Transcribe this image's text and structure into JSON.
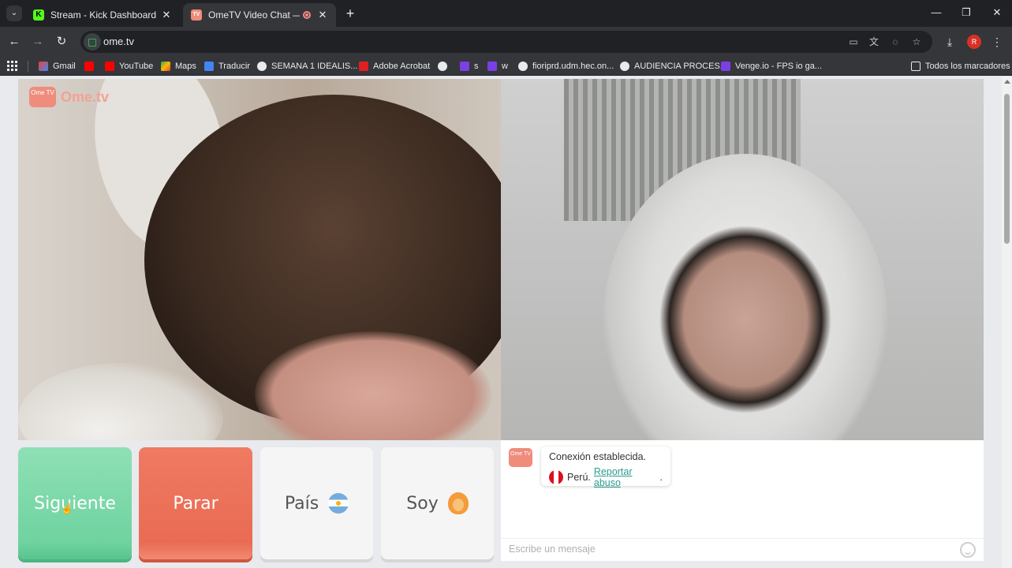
{
  "browser": {
    "tabs": [
      {
        "title": "Stream - Kick Dashboard",
        "favicon": "kick-icon",
        "active": false
      },
      {
        "title": "OmeTV Video Chat — Ome",
        "favicon": "ometv-icon",
        "active": true,
        "recording": true
      }
    ],
    "url": "ome.tv",
    "profile_initial": "R",
    "bookmarks": [
      {
        "label": "Gmail",
        "icon": "gmail-icon"
      },
      {
        "label": "",
        "icon": "youtube-icon"
      },
      {
        "label": "YouTube",
        "icon": "youtube-icon"
      },
      {
        "label": "Maps",
        "icon": "maps-icon"
      },
      {
        "label": "Traducir",
        "icon": "translate-icon"
      },
      {
        "label": "SEMANA 1 IDEALIS...",
        "icon": "globe-icon"
      },
      {
        "label": "Adobe Acrobat",
        "icon": "acrobat-icon"
      },
      {
        "label": "",
        "icon": "globe-icon"
      },
      {
        "label": "s",
        "icon": "venge-icon"
      },
      {
        "label": "w",
        "icon": "venge-icon"
      },
      {
        "label": "fioriprd.udm.hec.on...",
        "icon": "globe-icon"
      },
      {
        "label": "AUDIENCIA PROCES...",
        "icon": "globe-icon"
      },
      {
        "label": "Venge.io - FPS io ga...",
        "icon": "venge-icon"
      }
    ],
    "all_bookmarks_label": "Todos los marcadores"
  },
  "app": {
    "logo_badge": "Ome TV",
    "logo_text": "Ome.tv",
    "buttons": {
      "next": "Siguiente",
      "stop": "Parar",
      "country": "País",
      "soy": "Soy"
    },
    "chat": {
      "status": "Conexión establecida.",
      "country": "Perú.",
      "report_link": "Reportar abuso",
      "report_suffix": ".",
      "placeholder": "Escribe un mensaje"
    }
  },
  "colors": {
    "next_button": "#6fd3a0",
    "stop_button": "#e96b53",
    "brand": "#ef8c7c",
    "link": "#2a9d8f"
  }
}
